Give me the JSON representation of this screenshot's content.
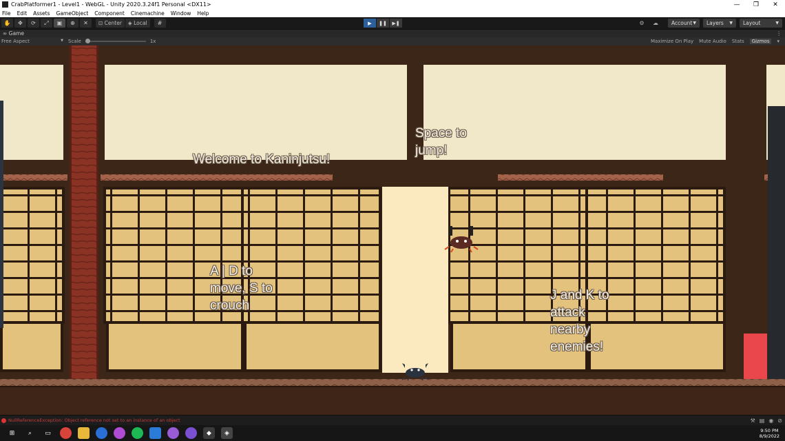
{
  "window": {
    "title": "CrabPlatformer1 - Level1 - WebGL - Unity 2020.3.24f1 Personal <DX11>",
    "controls": [
      "—",
      "❐",
      "✕"
    ]
  },
  "menubar": {
    "items": [
      "File",
      "Edit",
      "Assets",
      "GameObject",
      "Component",
      "Cinemachine",
      "Window",
      "Help"
    ]
  },
  "toolbar": {
    "tools": [
      "hand-tool",
      "move-tool",
      "rotate-tool",
      "scale-tool",
      "rect-tool",
      "transform-tool",
      "custom-tool"
    ],
    "pivot_label": "Center",
    "space_label": "Local",
    "account_label": "Account",
    "layers_label": "Layers",
    "layout_label": "Layout"
  },
  "game_tab": {
    "label": "Game",
    "aspect": "Free Aspect",
    "scale_label": "Scale",
    "scale_value": "1x",
    "maximize_label": "Maximize On Play",
    "mute_label": "Mute Audio",
    "stats_label": "Stats",
    "gizmos_label": "Gizmos"
  },
  "game_view": {
    "texts": {
      "welcome": "Welcome to Kaninjutsu!",
      "jump": "Space to\njump!",
      "move": "A | D to\nmove, S to\ncrouch",
      "attack": "J and K to\nattack\nnearby\nenemies!"
    }
  },
  "console": {
    "error": "NullReferenceException: Object reference not set to an instance of an object"
  },
  "taskbar": {
    "time": "9:50 PM",
    "date": "8/9/2022"
  },
  "colors": {
    "editor_bg": "#191919",
    "play_active": "#2d5f99",
    "wall": "#3b2618",
    "paper": "#f1e7c9",
    "shoji": "#e3c27d",
    "pillar": "#8a3324",
    "goal": "#e9474b"
  }
}
